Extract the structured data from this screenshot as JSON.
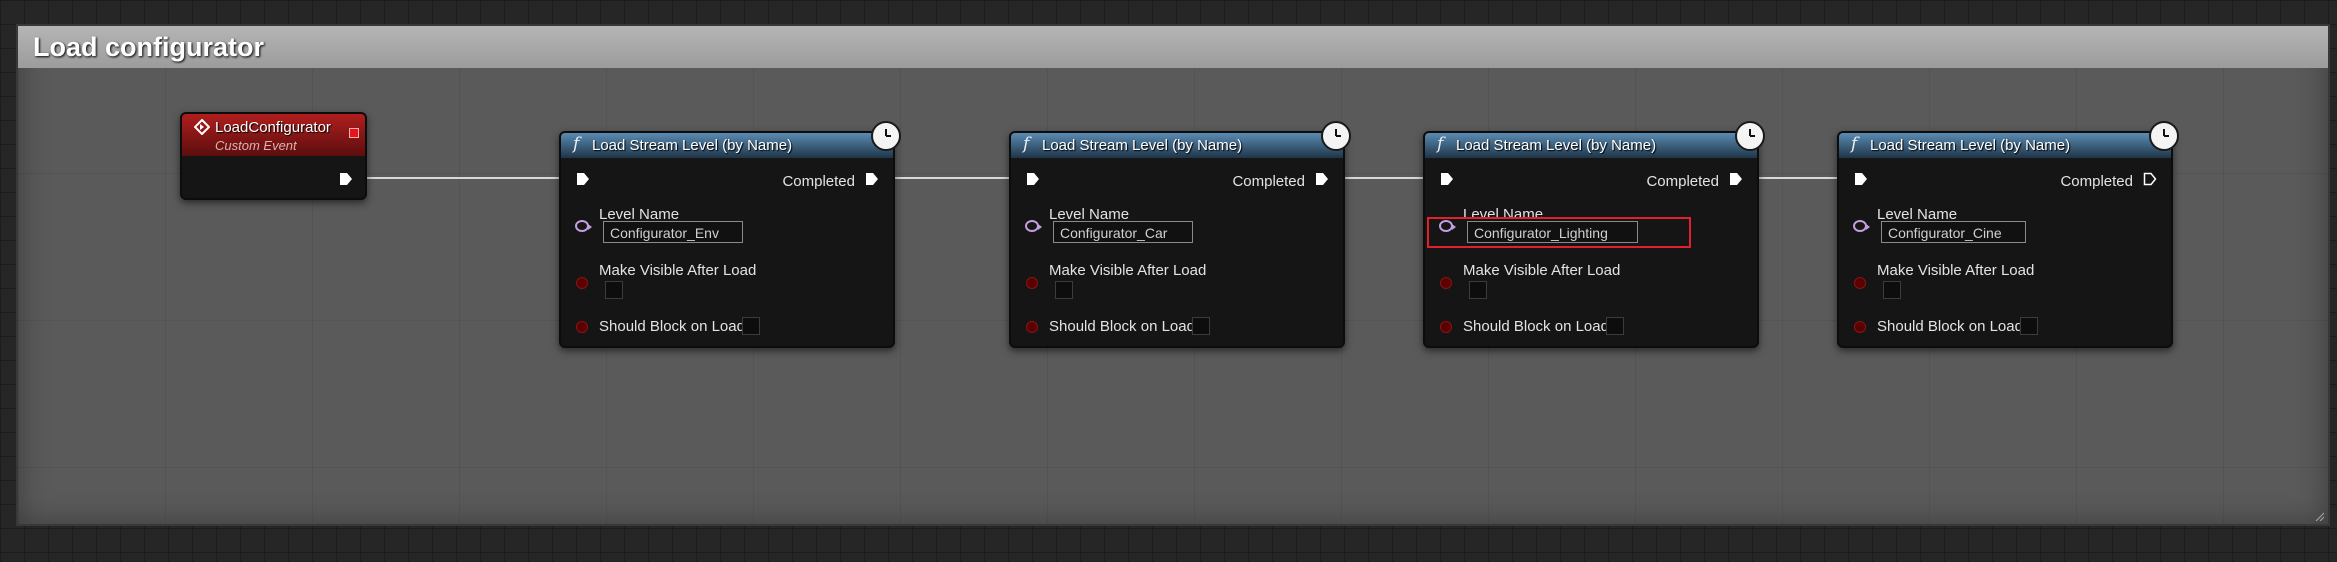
{
  "comment": {
    "title": "Load configurator"
  },
  "event_node": {
    "title": "LoadConfigurator",
    "subtitle": "Custom Event"
  },
  "nodes": [
    {
      "title": "Load Stream Level (by Name)",
      "fn_icon": "f",
      "completed_label": "Completed",
      "level_name_label": "Level Name",
      "level_name_value": "Configurator_Env",
      "make_visible_label": "Make Visible After Load",
      "should_block_label": "Should Block on Load"
    },
    {
      "title": "Load Stream Level (by Name)",
      "fn_icon": "f",
      "completed_label": "Completed",
      "level_name_label": "Level Name",
      "level_name_value": "Configurator_Car",
      "make_visible_label": "Make Visible After Load",
      "should_block_label": "Should Block on Load"
    },
    {
      "title": "Load Stream Level (by Name)",
      "fn_icon": "f",
      "completed_label": "Completed",
      "level_name_label": "Level Name",
      "level_name_value": "Configurator_Lighting",
      "make_visible_label": "Make Visible After Load",
      "should_block_label": "Should Block on Load"
    },
    {
      "title": "Load Stream Level (by Name)",
      "fn_icon": "f",
      "completed_label": "Completed",
      "level_name_label": "Level Name",
      "level_name_value": "Configurator_Cine",
      "make_visible_label": "Make Visible After Load",
      "should_block_label": "Should Block on Load"
    }
  ],
  "colors": {
    "function_header": "#3a668c",
    "event_header": "#a01818",
    "exec_wire": "#d8d8d8",
    "string_pin": "#c49ee0",
    "bool_pin": "#8a1414",
    "highlight": "#e0202c"
  },
  "icons": {
    "event": "diamond-event-icon",
    "latent": "clock-icon",
    "exec": "exec-arrow-icon",
    "delegate": "delegate-pin-icon"
  }
}
